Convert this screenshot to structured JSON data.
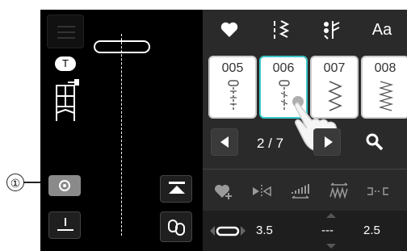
{
  "callout": {
    "number": "①"
  },
  "left_panel": {
    "foot_letter": "T"
  },
  "tabs": [
    {
      "name": "favorites",
      "icon": "heart-icon"
    },
    {
      "name": "utility-stitches",
      "icon": "stitch-pattern-icon"
    },
    {
      "name": "decorative-stitches",
      "icon": "decorative-stitch-icon"
    },
    {
      "name": "fonts",
      "label": "Aa"
    }
  ],
  "stitches": [
    {
      "number": "005"
    },
    {
      "number": "006"
    },
    {
      "number": "007"
    },
    {
      "number": "008"
    }
  ],
  "pager": {
    "page": "2 / 7"
  },
  "settings": {
    "width_value": "3.5",
    "length_value": "---",
    "tension_value": "2.5"
  },
  "colors": {
    "background": "#000000",
    "selected_border": "#3cc6c8",
    "panel": "#2a2a2a"
  }
}
